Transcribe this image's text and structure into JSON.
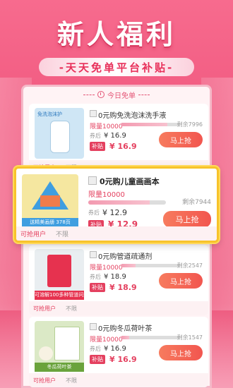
{
  "hero": {
    "title": "新人福利",
    "subtitle": "-天天免单平台补贴-"
  },
  "panel": {
    "header": "今日免单"
  },
  "products": [
    {
      "title": "0元购免洗泡沫洗手液",
      "limit": "限量10000",
      "stock": "剩余7996",
      "stock_fraction": 0.8,
      "coupon_label": "券后",
      "coupon_price": "¥ 16.9",
      "subsidy_label": "补贴",
      "subsidy_price": "¥ 16.9",
      "button": "马上抢",
      "image_label": "免洗泡沫护",
      "ribbon": "",
      "foot_users": "可抢用户",
      "foot_limit": "不限",
      "image_color": "#cfe6f5"
    },
    {
      "title": "0元购儿童画画本",
      "limit": "限量10000",
      "stock": "剩余7944",
      "stock_fraction": 0.79,
      "coupon_label": "券后",
      "coupon_price": "¥ 12.9",
      "subsidy_label": "补贴",
      "subsidy_price": "¥ 12.9",
      "button": "马上抢",
      "image_label": "",
      "ribbon": "送精美画册  378页",
      "foot_users": "可抢用户",
      "foot_limit": "不限",
      "image_color": "#f5e7a0"
    },
    {
      "title": "0元购管道疏通剂",
      "limit": "限量10000",
      "stock": "剩余2547",
      "stock_fraction": 0.25,
      "coupon_label": "券后",
      "coupon_price": "¥ 18.9",
      "subsidy_label": "补贴",
      "subsidy_price": "¥ 18.9",
      "button": "马上抢",
      "image_label": "",
      "ribbon": "可溶解100多种管道问题",
      "foot_users": "可抢用户",
      "foot_limit": "不限",
      "image_color": "#e9eef1"
    },
    {
      "title": "0元购冬瓜荷叶茶",
      "limit": "限量10000",
      "stock": "剩余1547",
      "stock_fraction": 0.15,
      "coupon_label": "券后",
      "coupon_price": "¥ 16.9",
      "subsidy_label": "补贴",
      "subsidy_price": "¥ 16.9",
      "button": "马上抢",
      "image_label": "",
      "ribbon": "冬瓜荷叶茶",
      "foot_users": "可抢用户",
      "foot_limit": "不限",
      "image_color": "#dbe9c6"
    }
  ]
}
